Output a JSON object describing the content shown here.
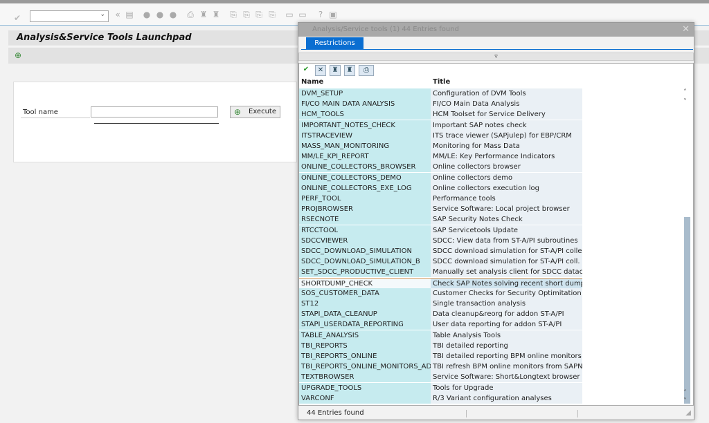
{
  "page": {
    "title": "Analysis&Service Tools Launchpad",
    "tool_name_label": "Tool name",
    "tool_name_value": "",
    "execute_label": "Execute"
  },
  "dialog": {
    "title": "Analysis/Service tools (1)   44 Entries found",
    "tab": "Restrictions",
    "columns": [
      "Name",
      "Title"
    ],
    "footer": "44 Entries found",
    "rows": [
      [
        "DVM_SETUP",
        "Configuration of DVM Tools"
      ],
      [
        "FI/CO MAIN DATA ANALYSIS",
        "FI/CO Main Data Analysis"
      ],
      [
        "HCM_TOOLS",
        "HCM Toolset for Service Delivery"
      ],
      [
        "IMPORTANT_NOTES_CHECK",
        "Important SAP notes check"
      ],
      [
        "ITSTRACEVIEW",
        "ITS trace viewer (SAPjulep) for EBP/CRM"
      ],
      [
        "MASS_MAN_MONITORING",
        "Monitoring for Mass Data"
      ],
      [
        "MM/LE_KPI_REPORT",
        "MM/LE: Key Performance Indicators"
      ],
      [
        "ONLINE_COLLECTORS_BROWSER",
        "Online collectors browser"
      ],
      [
        "ONLINE_COLLECTORS_DEMO",
        "Online collectors demo"
      ],
      [
        "ONLINE_COLLECTORS_EXE_LOG",
        "Online collectors execution log"
      ],
      [
        "PERF_TOOL",
        "Performance tools"
      ],
      [
        "PROJBROWSER",
        "Service Software: Local project browser"
      ],
      [
        "RSECNOTE",
        "SAP Security Notes Check"
      ],
      [
        "RTCCTOOL",
        "SAP Servicetools Update"
      ],
      [
        "SDCCVIEWER",
        "SDCC: View data from ST-A/PI subroutines"
      ],
      [
        "SDCC_DOWNLOAD_SIMULATION",
        "SDCC download simulation for ST-A/PI collectors"
      ],
      [
        "SDCC_DOWNLOAD_SIMULATION_B",
        "SDCC download simulation for ST-A/PI coll. Bin."
      ],
      [
        "SET_SDCC_PRODUCTIVE_CLIENT",
        "Manually set analysis client for SDCC datacollecto"
      ],
      [
        "SHORTDUMP_CHECK",
        "Check SAP Notes solving recent short dumps"
      ],
      [
        "SOS_CUSTOMER_DATA",
        "Customer Checks for Security Optimitation"
      ],
      [
        "ST12",
        "Single transaction analysis"
      ],
      [
        "STAPI_DATA_CLEANUP",
        "Data cleanup&reorg for addon ST-A/PI"
      ],
      [
        "STAPI_USERDATA_REPORTING",
        "User data reporting for addon ST-A/PI"
      ],
      [
        "TABLE_ANALYSIS",
        "Table Analysis Tools"
      ],
      [
        "TBI_REPORTS",
        "TBI detailed reporting"
      ],
      [
        "TBI_REPORTS_ONLINE",
        "TBI detailed reporting BPM online monitors"
      ],
      [
        "TBI_REPORTS_ONLINE_MONITORS_ADMI",
        "TBI refresh BPM online monitors from SAPNet"
      ],
      [
        "TEXTBROWSER",
        "Service Software: Short&Longtext browser"
      ],
      [
        "UPGRADE_TOOLS",
        "Tools for Upgrade"
      ],
      [
        "VARCONF",
        "R/3 Variant configuration analyses"
      ]
    ],
    "selected_index": 18
  }
}
